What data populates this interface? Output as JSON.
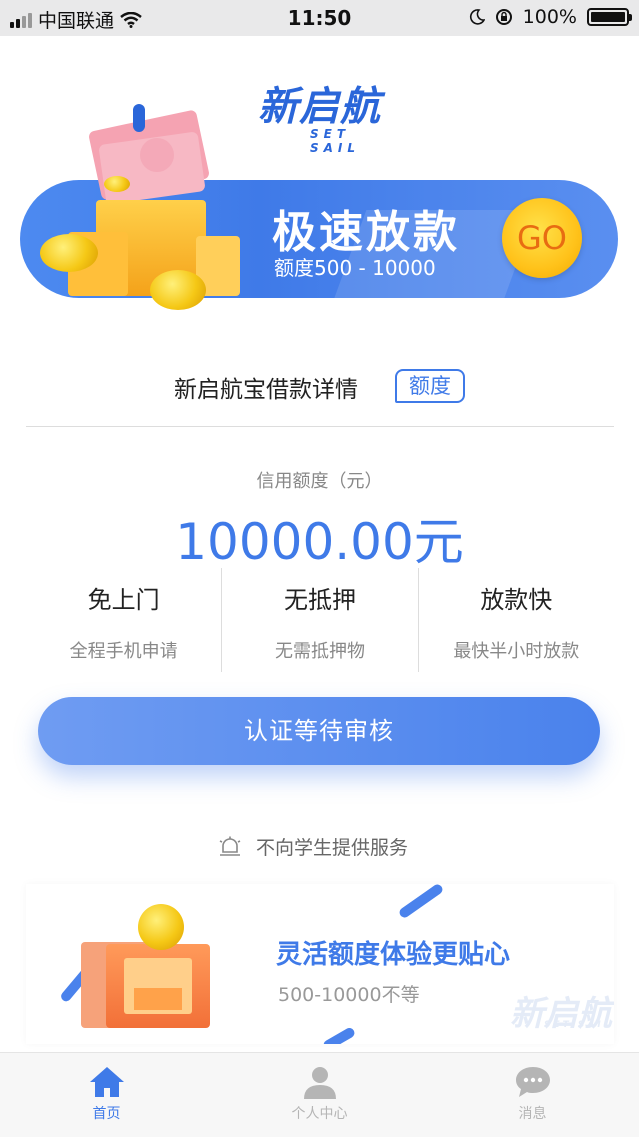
{
  "status_bar": {
    "carrier": "中国联通",
    "time": "11:50",
    "battery": "100%"
  },
  "logo": {
    "text": "新启航",
    "sub": "SET SAIL"
  },
  "banner": {
    "title": "极速放款",
    "subtitle": "额度500 - 10000",
    "go_label": "GO"
  },
  "section": {
    "title": "新启航宝借款详情",
    "tag": "额度"
  },
  "credit": {
    "label": "信用额度（元）",
    "value": "10000.00元"
  },
  "features": [
    {
      "title": "免上门",
      "desc": "全程手机申请"
    },
    {
      "title": "无抵押",
      "desc": "无需抵押物"
    },
    {
      "title": "放款快",
      "desc": "最快半小时放款"
    }
  ],
  "cta": {
    "label": "认证等待审核"
  },
  "notice": {
    "text": "不向学生提供服务"
  },
  "promo": {
    "title": "灵活额度体验更贴心",
    "subtitle": "500-10000不等"
  },
  "tabs": [
    {
      "label": "首页",
      "icon": "home-icon",
      "active": true
    },
    {
      "label": "个人中心",
      "icon": "person-icon",
      "active": false
    },
    {
      "label": "消息",
      "icon": "message-icon",
      "active": false
    }
  ],
  "colors": {
    "accent": "#3f7ae8",
    "gold": "#ffc21a",
    "muted": "#888888"
  }
}
